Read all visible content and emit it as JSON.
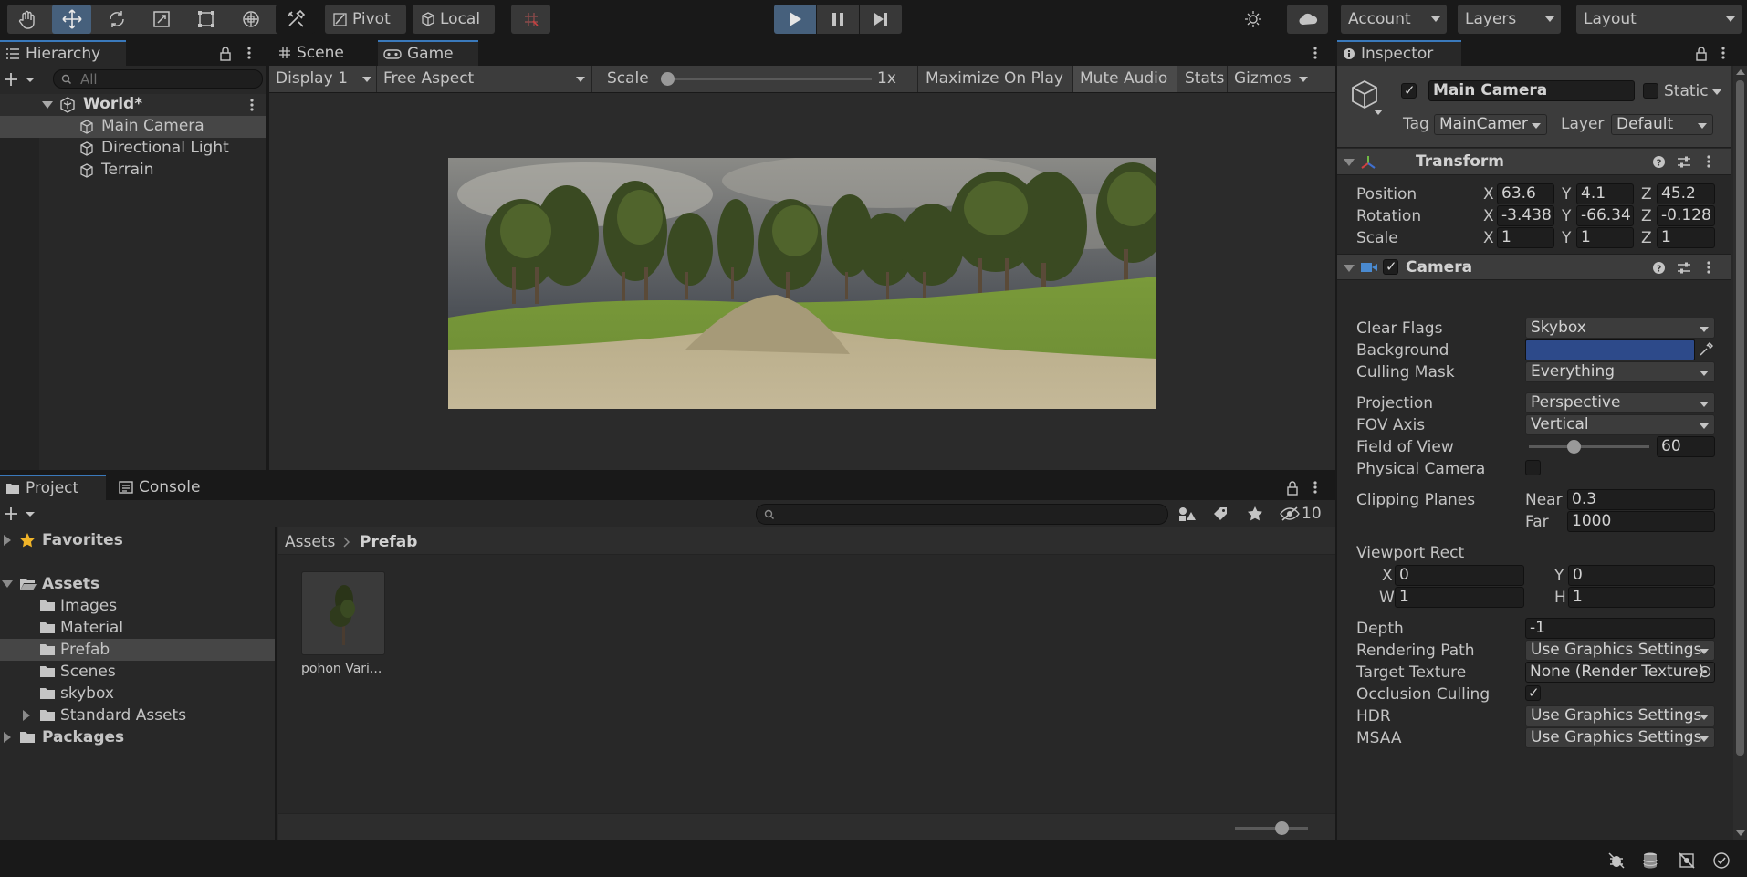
{
  "toolbar": {
    "pivot_label": "Pivot",
    "local_label": "Local",
    "account_label": "Account",
    "layers_label": "Layers",
    "layout_label": "Layout"
  },
  "hierarchy": {
    "tab_label": "Hierarchy",
    "search_placeholder": "All",
    "scene_name": "World*",
    "items": [
      {
        "label": "Main Camera"
      },
      {
        "label": "Directional Light"
      },
      {
        "label": "Terrain"
      }
    ]
  },
  "game_view": {
    "tabs": [
      {
        "label": "Scene"
      },
      {
        "label": "Game"
      }
    ],
    "display_label": "Display 1",
    "aspect_label": "Free Aspect",
    "scale_label": "Scale",
    "scale_value": "1x",
    "maximize_label": "Maximize On Play",
    "mute_label": "Mute Audio",
    "stats_label": "Stats",
    "gizmos_label": "Gizmos"
  },
  "project": {
    "tabs": [
      {
        "label": "Project"
      },
      {
        "label": "Console"
      }
    ],
    "hidden_count": "10",
    "favorites_label": "Favorites",
    "assets_label": "Assets",
    "folders": [
      {
        "label": "Images"
      },
      {
        "label": "Material"
      },
      {
        "label": "Prefab"
      },
      {
        "label": "Scenes"
      },
      {
        "label": "skybox"
      },
      {
        "label": "Standard Assets"
      }
    ],
    "packages_label": "Packages",
    "breadcrumb_root": "Assets",
    "breadcrumb_current": "Prefab",
    "asset_item_label": "pohon Vari..."
  },
  "inspector": {
    "tab_label": "Inspector",
    "object_name": "Main Camera",
    "static_label": "Static",
    "tag_label": "Tag",
    "tag_value": "MainCamer",
    "layer_label": "Layer",
    "layer_value": "Default",
    "transform": {
      "title": "Transform",
      "position_label": "Position",
      "rotation_label": "Rotation",
      "scale_label": "Scale",
      "position": {
        "x": "63.6",
        "y": "4.1",
        "z": "45.2"
      },
      "rotation": {
        "x": "-3.438",
        "y": "-66.34",
        "z": "-0.128"
      },
      "scale": {
        "x": "1",
        "y": "1",
        "z": "1"
      },
      "x_label": "X",
      "y_label": "Y",
      "z_label": "Z"
    },
    "camera": {
      "title": "Camera",
      "clear_flags_label": "Clear Flags",
      "clear_flags_value": "Skybox",
      "background_label": "Background",
      "background_color": "#2d4a8a",
      "culling_mask_label": "Culling Mask",
      "culling_mask_value": "Everything",
      "projection_label": "Projection",
      "projection_value": "Perspective",
      "fov_axis_label": "FOV Axis",
      "fov_axis_value": "Vertical",
      "fov_label": "Field of View",
      "fov_value": "60",
      "physical_camera_label": "Physical Camera",
      "clipping_planes_label": "Clipping Planes",
      "near_label": "Near",
      "near_value": "0.3",
      "far_label": "Far",
      "far_value": "1000",
      "viewport_rect_label": "Viewport Rect",
      "vp_x_label": "X",
      "vp_x": "0",
      "vp_y_label": "Y",
      "vp_y": "0",
      "vp_w_label": "W",
      "vp_w": "1",
      "vp_h_label": "H",
      "vp_h": "1",
      "depth_label": "Depth",
      "depth_value": "-1",
      "rendering_path_label": "Rendering Path",
      "rendering_path_value": "Use Graphics Settings",
      "target_texture_label": "Target Texture",
      "target_texture_value": "None (Render Texture)",
      "occlusion_label": "Occlusion Culling",
      "hdr_label": "HDR",
      "hdr_value": "Use Graphics Settings",
      "msaa_label": "MSAA",
      "msaa_value": "Use Graphics Settings"
    }
  },
  "colors": {
    "accent": "#3a79bb",
    "play_active": "#46607c",
    "panel": "#282828",
    "toolbar": "#191919"
  }
}
